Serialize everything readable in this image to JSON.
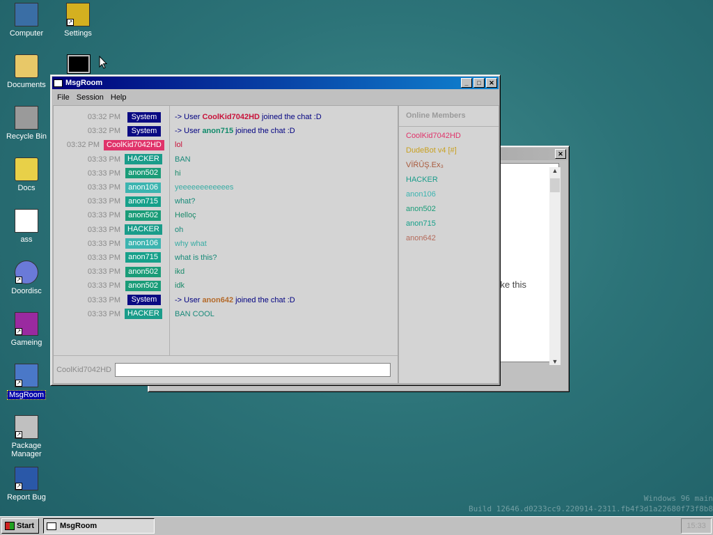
{
  "desktop": {
    "icons": [
      {
        "label": "Computer",
        "icon": "computer-icon"
      },
      {
        "label": "Settings",
        "icon": "settings-icon"
      },
      {
        "label": "Documents",
        "icon": "documents-folder-icon"
      },
      {
        "label": "Recycle Bin",
        "icon": "recycle-bin-icon"
      },
      {
        "label": "Docs",
        "icon": "folder-icon"
      },
      {
        "label": "ass",
        "icon": "file-icon"
      },
      {
        "label": "Doordisc",
        "icon": "doordisc-icon"
      },
      {
        "label": "Gameing",
        "icon": "gameing-icon"
      },
      {
        "label": "MsgRoom",
        "icon": "msgroom-icon"
      },
      {
        "label": "Package Manager",
        "icon": "package-manager-icon"
      },
      {
        "label": "Report Bug",
        "icon": "report-bug-icon"
      }
    ],
    "watermark": {
      "line1": "Windows 96 main",
      "line2": "Build 12646.d0233cc9.220914-2311.fb4f3d1a22680f73f8b8"
    }
  },
  "msgroom": {
    "title": "MsgRoom",
    "menu": [
      "File",
      "Session",
      "Help"
    ],
    "messages": [
      {
        "time": "03:32 PM",
        "user": "System",
        "user_color": "#0a0a82",
        "parts": [
          {
            "t": "-> User ",
            "c": "#000080"
          },
          {
            "t": "CoolKid7042HD",
            "c": "#c8123a",
            "b": true
          },
          {
            "t": " joined the chat :D",
            "c": "#000080"
          }
        ]
      },
      {
        "time": "03:32 PM",
        "user": "System",
        "user_color": "#0a0a82",
        "parts": [
          {
            "t": "-> User ",
            "c": "#000080"
          },
          {
            "t": "anon715",
            "c": "#108a6a",
            "b": true
          },
          {
            "t": " joined the chat :D",
            "c": "#000080"
          }
        ]
      },
      {
        "time": "03:32 PM",
        "user": "CoolKid7042HD",
        "user_color": "#e0336a",
        "parts": [
          {
            "t": "lol",
            "c": "#c8123a"
          }
        ]
      },
      {
        "time": "03:33 PM",
        "user": "HACKER",
        "user_color": "#1a9c8a",
        "parts": [
          {
            "t": "BAN",
            "c": "#1a8a7a"
          }
        ]
      },
      {
        "time": "03:33 PM",
        "user": "anon502",
        "user_color": "#1a9c78",
        "parts": [
          {
            "t": "hi",
            "c": "#1a8a6a"
          }
        ]
      },
      {
        "time": "03:33 PM",
        "user": "anon106",
        "user_color": "#3cb4b0",
        "parts": [
          {
            "t": "yeeeeeeeeeeees",
            "c": "#38aca4"
          }
        ]
      },
      {
        "time": "03:33 PM",
        "user": "anon715",
        "user_color": "#16a08a",
        "parts": [
          {
            "t": "what?",
            "c": "#168a78"
          }
        ]
      },
      {
        "time": "03:33 PM",
        "user": "anon502",
        "user_color": "#1a9c78",
        "parts": [
          {
            "t": "Helloç",
            "c": "#1a8a6a"
          }
        ]
      },
      {
        "time": "03:33 PM",
        "user": "HACKER",
        "user_color": "#1a9c8a",
        "parts": [
          {
            "t": "oh",
            "c": "#1a8a7a"
          }
        ]
      },
      {
        "time": "03:33 PM",
        "user": "anon106",
        "user_color": "#3cb4b0",
        "parts": [
          {
            "t": "why what",
            "c": "#38aca4"
          }
        ]
      },
      {
        "time": "03:33 PM",
        "user": "anon715",
        "user_color": "#16a08a",
        "parts": [
          {
            "t": "what is this?",
            "c": "#168a78"
          }
        ]
      },
      {
        "time": "03:33 PM",
        "user": "anon502",
        "user_color": "#1a9c78",
        "parts": [
          {
            "t": "ikd",
            "c": "#1a8a6a"
          }
        ]
      },
      {
        "time": "03:33 PM",
        "user": "anon502",
        "user_color": "#1a9c78",
        "parts": [
          {
            "t": "idk",
            "c": "#1a8a6a"
          }
        ]
      },
      {
        "time": "03:33 PM",
        "user": "System",
        "user_color": "#0a0a82",
        "parts": [
          {
            "t": "-> User ",
            "c": "#000080"
          },
          {
            "t": "anon642",
            "c": "#b46a2a",
            "b": true
          },
          {
            "t": " joined the chat :D",
            "c": "#000080"
          }
        ]
      },
      {
        "time": "03:33 PM",
        "user": "HACKER",
        "user_color": "#1a9c8a",
        "parts": [
          {
            "t": "BAN COOL",
            "c": "#1a8a7a"
          }
        ]
      }
    ],
    "members_title": "Online Members",
    "members": [
      {
        "name": "CoolKid7042HD",
        "color": "#e0336a"
      },
      {
        "name": "DudeBot v4 [#]",
        "color": "#c8a020"
      },
      {
        "name": "VÏŔÛŞ.Ex₃",
        "color": "#a8583a"
      },
      {
        "name": "HACKER",
        "color": "#1a9c8a"
      },
      {
        "name": "anon106",
        "color": "#3cb4b0"
      },
      {
        "name": "anon502",
        "color": "#1a9c78"
      },
      {
        "name": "anon715",
        "color": "#16a08a"
      },
      {
        "name": "anon642",
        "color": "#b46a5a"
      }
    ],
    "input_user": "CoolKid7042HD",
    "input_value": ""
  },
  "background_window": {
    "partial_text": "nake this"
  },
  "taskbar": {
    "start_label": "Start",
    "task_label": "MsgRoom",
    "clock": "15:33"
  }
}
